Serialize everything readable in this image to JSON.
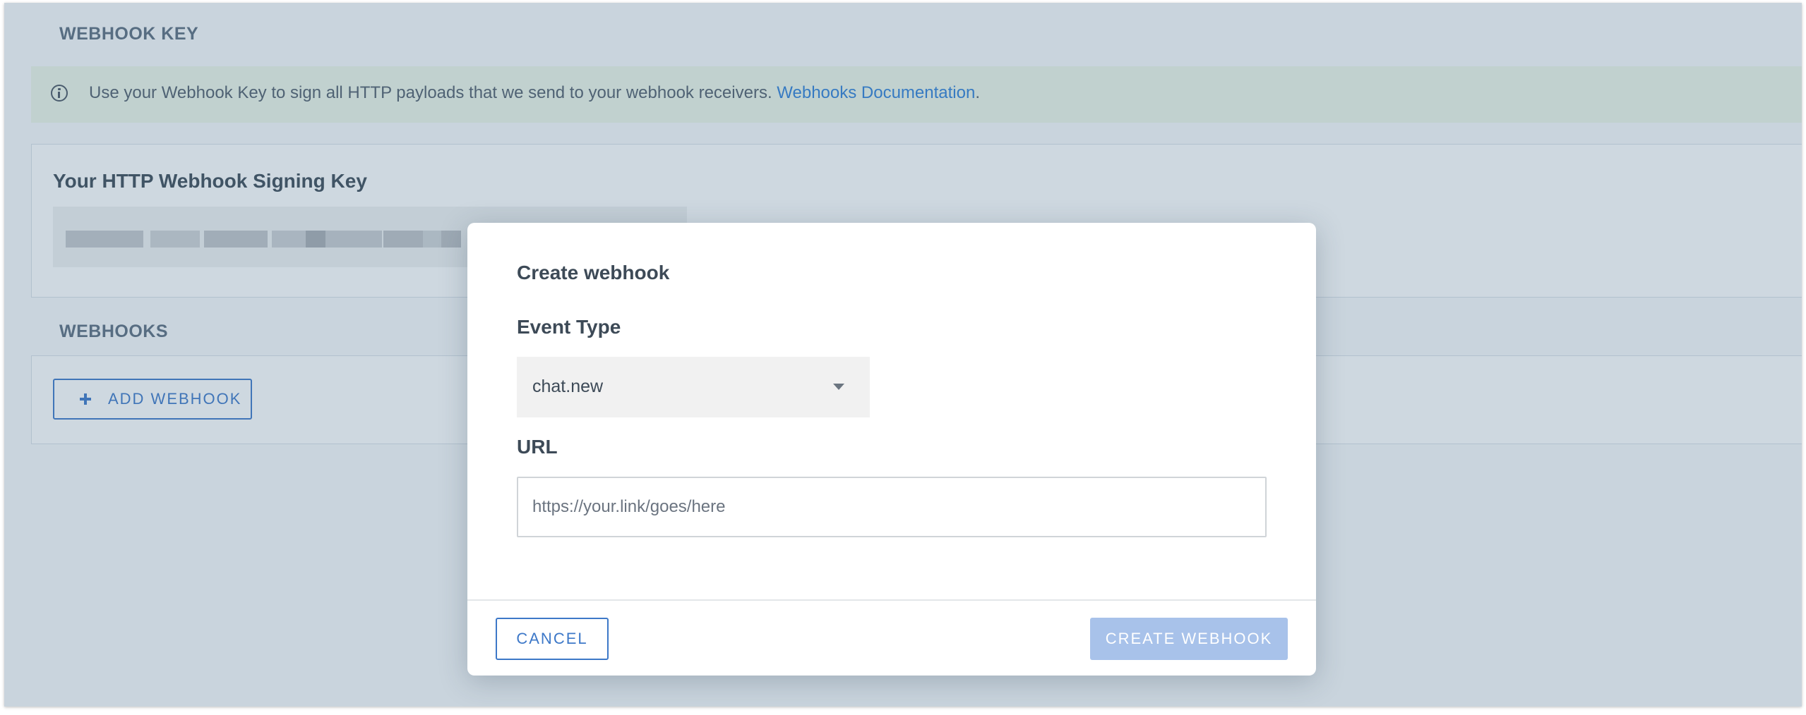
{
  "webhook_key_section": {
    "title": "WEBHOOK KEY"
  },
  "info_banner": {
    "icon": "info-circle-icon",
    "text": "Use your Webhook Key to sign all HTTP payloads that we send to your webhook receivers. ",
    "link_text": "Webhooks Documentation",
    "trailing": "."
  },
  "signing_key_card": {
    "title": "Your HTTP Webhook Signing Key",
    "key_value_state": "blurred"
  },
  "webhooks_section": {
    "title": "WEBHOOKS",
    "add_button_icon": "plus-icon",
    "add_button_label": "ADD WEBHOOK"
  },
  "modal": {
    "title": "Create webhook",
    "event_type_label": "Event Type",
    "event_type_value": "chat.new",
    "url_label": "URL",
    "url_value": "",
    "url_placeholder": "https://your.link/goes/here",
    "cancel_label": "CANCEL",
    "create_label": "CREATE WEBHOOK",
    "create_enabled": false
  },
  "colors": {
    "accent": "#3d78c8",
    "link": "#2f7fd6",
    "info_background": "#eef6e8",
    "disabled_button": "#a8c2ea",
    "overlay": "#4a708c"
  }
}
